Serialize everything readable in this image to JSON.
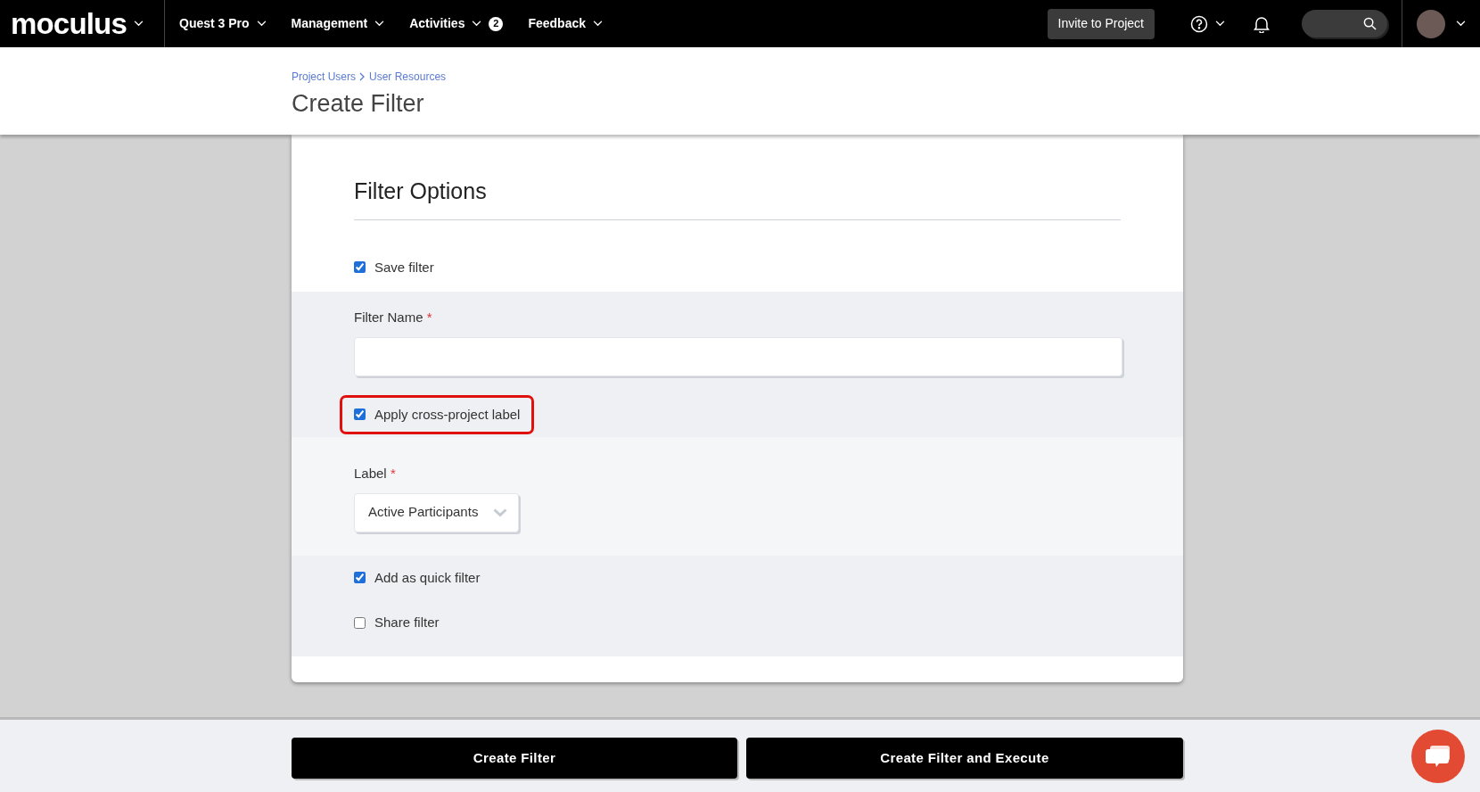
{
  "nav": {
    "logo": "moculus",
    "menus": [
      {
        "label": "Quest 3 Pro"
      },
      {
        "label": "Management"
      },
      {
        "label": "Activities",
        "badge": "2"
      },
      {
        "label": "Feedback"
      }
    ],
    "invite_button": "Invite to Project"
  },
  "header": {
    "breadcrumb": [
      "Project Users",
      "User Resources"
    ],
    "title": "Create Filter"
  },
  "form": {
    "title": "Filter Options",
    "sections": [
      {
        "items": [
          {
            "kind": "checkbox",
            "label": "Save filter",
            "checked": true,
            "highlighted": false
          }
        ]
      },
      {
        "items": [
          {
            "kind": "text",
            "label": "Filter Name",
            "required_mark": "*"
          },
          {
            "kind": "checkbox",
            "label": "Apply cross-project label",
            "checked": true,
            "highlighted": true
          }
        ]
      },
      {
        "items": [
          {
            "kind": "select",
            "label": "Label",
            "required_mark": "*",
            "value": "Active Participants"
          }
        ]
      },
      {
        "items": [
          {
            "kind": "checkbox",
            "label": "Add as quick filter",
            "checked": true,
            "highlighted": false
          },
          {
            "kind": "checkbox",
            "label": "Share filter",
            "checked": false,
            "highlighted": false
          }
        ]
      }
    ]
  },
  "footer": {
    "buttons": [
      "Create Filter",
      "Create Filter and Execute"
    ]
  }
}
